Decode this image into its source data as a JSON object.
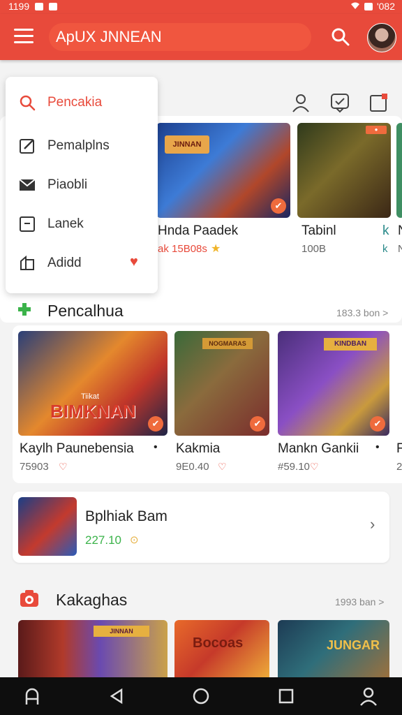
{
  "status": {
    "time": "1199",
    "battery": "'082"
  },
  "appbar": {
    "title": "ApUX JNNEAN"
  },
  "drawer": {
    "items": [
      {
        "label": "Pencakia"
      },
      {
        "label": "Pemalplns"
      },
      {
        "label": "Piaobli"
      },
      {
        "label": "Lanek"
      },
      {
        "label": "Adidd"
      }
    ]
  },
  "top_row": {
    "cards": [
      {
        "title": "Hnda Paadek",
        "sub": "ak 15B08s"
      },
      {
        "title": "Tabinl",
        "sub": "100B"
      },
      {
        "title": "k",
        "sub": "k"
      },
      {
        "title": "N",
        "sub": "N"
      }
    ]
  },
  "section1": {
    "title": "Pencalhua",
    "more": "183.3 bon >",
    "cards": [
      {
        "title": "Kaylh Paunebensia",
        "sub": "75903"
      },
      {
        "title": "Kakmia",
        "sub": "9E0.40"
      },
      {
        "title": "Mankn Gankii",
        "sub": "#59.10"
      },
      {
        "title": "F",
        "sub": "2"
      }
    ],
    "poster_caption": "BIMKNAN",
    "poster_small": "Tiikat"
  },
  "banner": {
    "title": "Bplhiak Bam",
    "value": "227.10"
  },
  "section2": {
    "title": "Kakaghas",
    "more": "1993 ban >"
  },
  "thumb_labels": {
    "t1": "JINNAN",
    "t2": "NOGMARAS",
    "t3": "KINDBAN",
    "t4": "Bocoas",
    "t5": "JUNGAR"
  },
  "colors": {
    "accent": "#e84a3b",
    "green": "#3bb34a",
    "badge": "#ef6b3d"
  }
}
